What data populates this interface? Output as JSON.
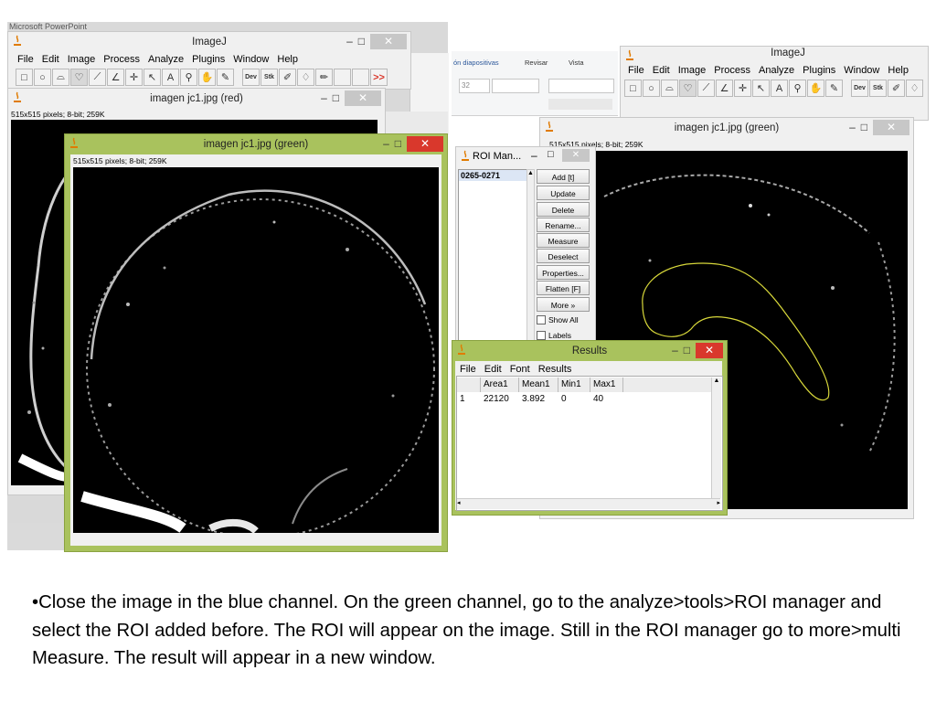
{
  "powerpoint_title": "Microsoft PowerPoint",
  "ppt_ribbon": {
    "tabs": [
      "ón diapositivas",
      "Revisar",
      "Vista"
    ],
    "font_size": "32"
  },
  "imagej_left": {
    "title": "ImageJ",
    "menu": [
      "File",
      "Edit",
      "Image",
      "Process",
      "Analyze",
      "Plugins",
      "Window",
      "Help"
    ],
    "dev_label": "Dev",
    "stk_label": "Stk",
    "more_label": ">>"
  },
  "img_red": {
    "title": "imagen jc1.jpg (red)",
    "info": "515x515 pixels; 8-bit; 259K"
  },
  "img_green_left": {
    "title": "imagen jc1.jpg (green)",
    "info": "515x515 pixels; 8-bit; 259K"
  },
  "imagej_right": {
    "title": "ImageJ",
    "menu": [
      "File",
      "Edit",
      "Image",
      "Process",
      "Analyze",
      "Plugins",
      "Window",
      "Help"
    ],
    "dev_label": "Dev",
    "stk_label": "Stk"
  },
  "img_green_right": {
    "title": "imagen jc1.jpg (green)",
    "info": "515x515 pixels; 8-bit; 259K"
  },
  "roi_manager": {
    "title": "ROI Man...",
    "items": [
      "0265-0271"
    ],
    "buttons": [
      "Add [t]",
      "Update",
      "Delete",
      "Rename...",
      "Measure",
      "Deselect",
      "Properties...",
      "Flatten [F]",
      "More »"
    ],
    "checkboxes": [
      "Show All",
      "Labels"
    ]
  },
  "results": {
    "title": "Results",
    "menu": [
      "File",
      "Edit",
      "Font",
      "Results"
    ],
    "columns": [
      "",
      "Area1",
      "Mean1",
      "Min1",
      "Max1"
    ],
    "rows": [
      [
        "1",
        "22120",
        "3.892",
        "0",
        "40"
      ]
    ]
  },
  "caption": "•Close the image in the blue channel. On the green channel, go to the analyze>tools>ROI manager and select the ROI added before. The ROI will appear on the image. Still in the ROI manager go to more>multi Measure. The result will appear in a new window.",
  "colors": {
    "window_frame": "#a9c25d",
    "roi_outline": "#d8d83a",
    "close_red": "#d9382c"
  }
}
